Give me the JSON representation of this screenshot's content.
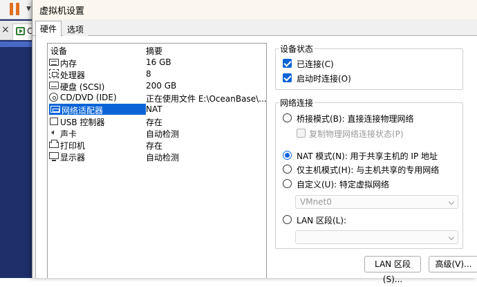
{
  "background_app": {
    "tab_partial_label": "C"
  },
  "dialog": {
    "title": "虚拟机设置",
    "tabs": [
      {
        "label": "硬件",
        "active": true
      },
      {
        "label": "选项",
        "active": false
      }
    ]
  },
  "device_list": {
    "col_device": "设备",
    "col_summary": "摘要",
    "rows": [
      {
        "icon": "memory-icon",
        "name": "内存",
        "summary": "16 GB"
      },
      {
        "icon": "processor-icon",
        "name": "处理器",
        "summary": "8"
      },
      {
        "icon": "hard-disk-icon",
        "name": "硬盘 (SCSI)",
        "summary": "200 GB"
      },
      {
        "icon": "cd-dvd-icon",
        "name": "CD/DVD (IDE)",
        "summary": "正在使用文件 E:\\OceanBase\\..."
      },
      {
        "icon": "network-adapter-icon",
        "name": "网络适配器",
        "summary": "NAT",
        "selected": true
      },
      {
        "icon": "usb-icon",
        "name": "USB 控制器",
        "summary": "存在"
      },
      {
        "icon": "sound-icon",
        "name": "声卡",
        "summary": "自动检测"
      },
      {
        "icon": "printer-icon",
        "name": "打印机",
        "summary": "存在"
      },
      {
        "icon": "display-icon",
        "name": "显示器",
        "summary": "自动检测"
      }
    ]
  },
  "device_status": {
    "title": "设备状态",
    "connected": {
      "label": "已连接(C)",
      "checked": true
    },
    "connect_at_power_on": {
      "label": "启动时连接(O)",
      "checked": true
    }
  },
  "network_connection": {
    "title": "网络连接",
    "bridged": {
      "label": "桥接模式(B): 直接连接物理网络",
      "selected": false
    },
    "replicate": {
      "label": "复制物理网络连接状态(P)",
      "checked": false
    },
    "nat": {
      "label": "NAT 模式(N): 用于共享主机的 IP 地址",
      "selected": true
    },
    "host_only": {
      "label": "仅主机模式(H): 与主机共享的专用网络",
      "selected": false
    },
    "custom": {
      "label": "自定义(U): 特定虚拟网络",
      "selected": false
    },
    "custom_value": "VMnet0",
    "lan_segment": {
      "label": "LAN 区段(L):",
      "selected": false
    },
    "lan_value": ""
  },
  "buttons": {
    "lan_segments": "LAN 区段(S)...",
    "advanced": "高级(V)..."
  },
  "colors": {
    "accent": "#0a64d8",
    "pause": "#e07020",
    "background_app": "#1f2f6a"
  }
}
